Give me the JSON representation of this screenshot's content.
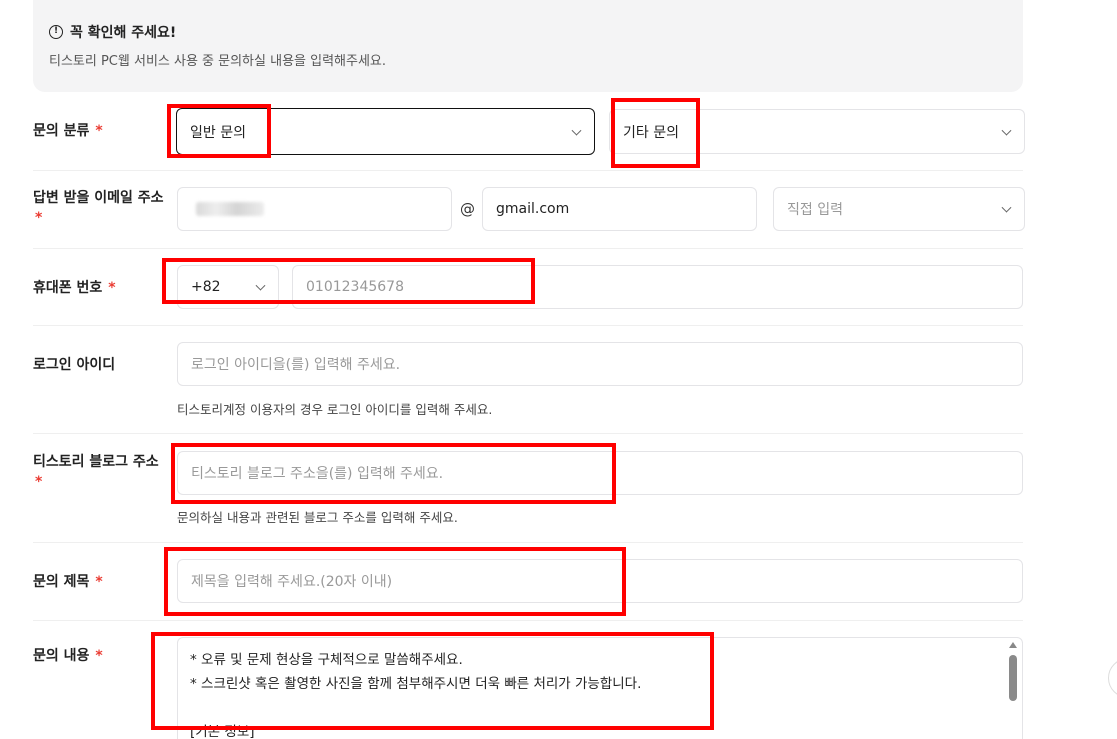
{
  "notice": {
    "title": "꼭 확인해 주세요!",
    "description": "티스토리 PC웹 서비스 사용 중 문의하실 내용을 입력해주세요."
  },
  "category": {
    "label": "문의 분류",
    "required_mark": "*",
    "primary_value": "일반 문의",
    "secondary_value": "기타 문의"
  },
  "email": {
    "label": "답변 받을 이메일 주소",
    "required_mark": "*",
    "at_sign": "@",
    "domain_value": "gmail.com",
    "domain_select_placeholder": "직접 입력"
  },
  "phone": {
    "label": "휴대폰 번호",
    "required_mark": "*",
    "country_code": "+82",
    "number_placeholder": "01012345678"
  },
  "login_id": {
    "label": "로그인 아이디",
    "placeholder": "로그인 아이디을(를) 입력해 주세요.",
    "hint": "티스토리계정 이용자의 경우 로그인 아이디를 입력해 주세요."
  },
  "blog_address": {
    "label": "티스토리 블로그 주소",
    "required_mark": "*",
    "placeholder": "티스토리 블로그 주소을(를) 입력해 주세요.",
    "hint": "문의하실 내용과 관련된 블로그 주소를 입력해 주세요."
  },
  "subject": {
    "label": "문의 제목",
    "required_mark": "*",
    "placeholder": "제목을 입력해 주세요.(20자 이내)"
  },
  "content": {
    "label": "문의 내용",
    "required_mark": "*",
    "lines": [
      "* 오류 및 문제 현상을 구체적으로 말씀해주세요.",
      "* 스크린샷 혹은 촬영한 사진을 함께 첨부해주시면 더욱 빠른 처리가 가능합니다.",
      "",
      "[기본 정보]"
    ]
  },
  "colors": {
    "required": "#ea3b32",
    "highlight": "#ff0000",
    "border": "#e4e4e7",
    "notice_bg": "#f4f4f5"
  }
}
